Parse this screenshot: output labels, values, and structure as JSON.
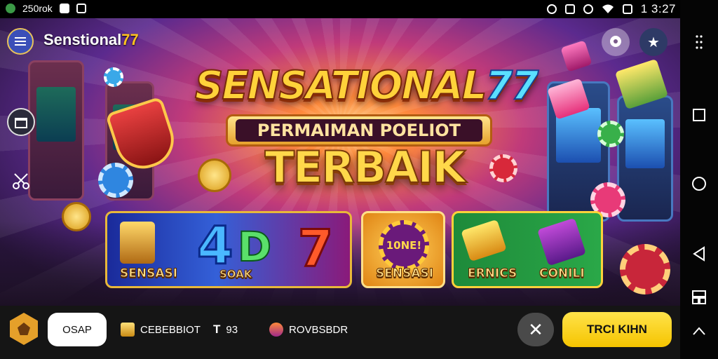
{
  "status_bar": {
    "left_text": "250rok",
    "time": "1 3:27",
    "icons": [
      "app-icon",
      "notification-icon",
      "gallery-icon",
      "alarm-icon",
      "mute-icon",
      "dnd-icon",
      "wifi-icon",
      "battery-icon"
    ]
  },
  "app": {
    "brand_name": "Senstional",
    "brand_number": "77"
  },
  "banner": {
    "title_text": "SENSATIONAL",
    "title_number": "77",
    "subtitle": "PERMAIMAN POELIOT",
    "headline": "TERBAIK"
  },
  "cards": [
    {
      "label": "SENSASI",
      "big_text": "4",
      "big_text_2": "D",
      "big_text_3": "7",
      "sub_label": "SOAK"
    },
    {
      "label": "SENSASI",
      "badge_text": "10NE!"
    },
    {
      "label": "ERNICS",
      "label_2": "CONILI"
    }
  ],
  "bottom_bar": {
    "pill_label": "OSAP",
    "item1": "CEBEBBIOT",
    "item2": "93",
    "item2_glyph": "T",
    "item3": "ROVBSBDR",
    "close_glyph": "✕",
    "cta_label": "TRCI KIHN"
  },
  "colors": {
    "accent_gold": "#ffc31f",
    "cta_yellow": "#f5c400",
    "menu_blue": "#3b4fb8"
  }
}
